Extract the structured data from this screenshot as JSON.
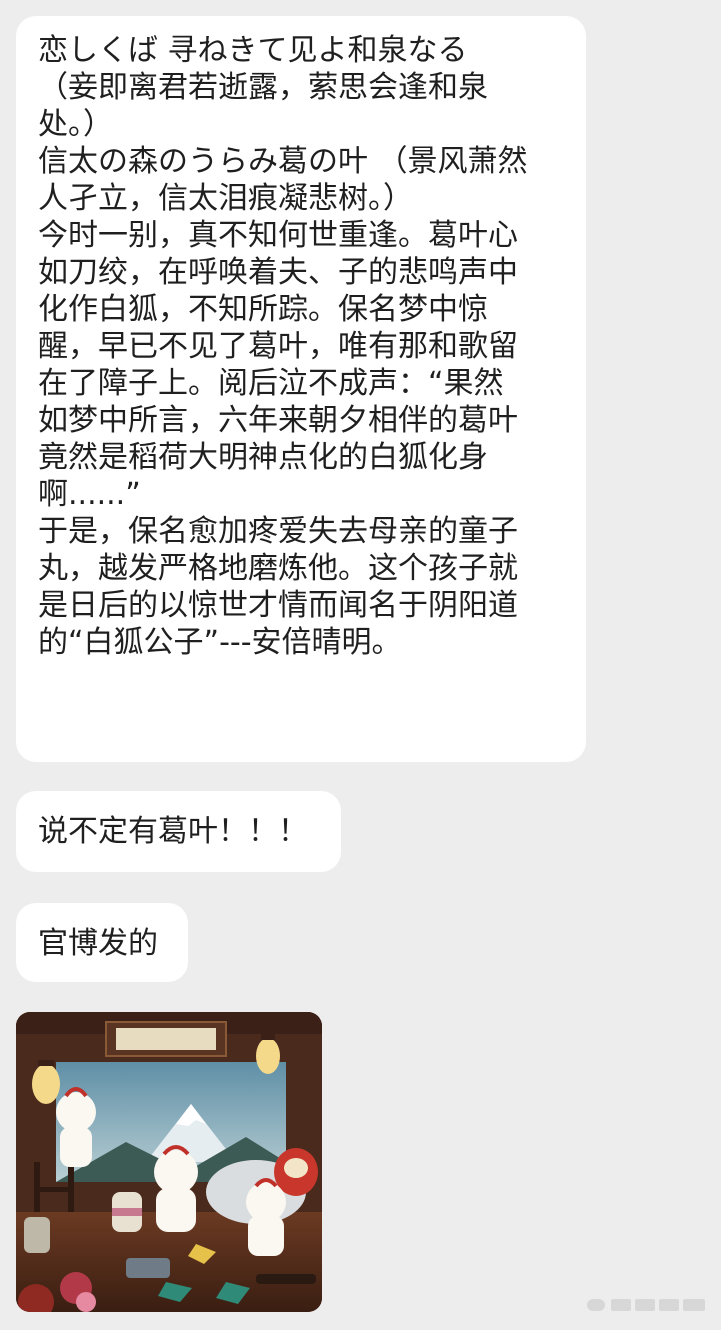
{
  "messages": [
    {
      "type": "text",
      "lines": [
        "恋しくば 寻ねきて见よ和泉なる",
        "（妾即离君若逝露，萦思会逢和泉",
        "处。）",
        "信太の森のうらみ葛の叶 （景风萧然",
        "人孑立，信太泪痕凝悲树。）",
        "今时一别，真不知何世重逢。葛叶心",
        "如刀绞，在呼唤着夫、子的悲鸣声中",
        "化作白狐，不知所踪。保名梦中惊",
        "醒，早已不见了葛叶，唯有那和歌留",
        "在了障子上。阅后泣不成声：“果然",
        "如梦中所言，六年来朝夕相伴的葛叶",
        "竟然是稻荷大明神点化的白狐化身",
        "啊......”",
        "于是，保名愈加疼爱失去母亲的童子",
        "丸，越发严格地磨炼他。这个孩子就",
        "是日后的以惊世才情而闻名于阴阳道",
        "的“白狐公子”---安倍晴明。"
      ]
    },
    {
      "type": "text",
      "text": "说不定有葛叶！！！"
    },
    {
      "type": "text",
      "text": "官博发的"
    },
    {
      "type": "image",
      "icon": "illustration-image"
    }
  ],
  "colors": {
    "background": "#ededed",
    "bubble": "#ffffff",
    "text": "#1f1f1f"
  }
}
